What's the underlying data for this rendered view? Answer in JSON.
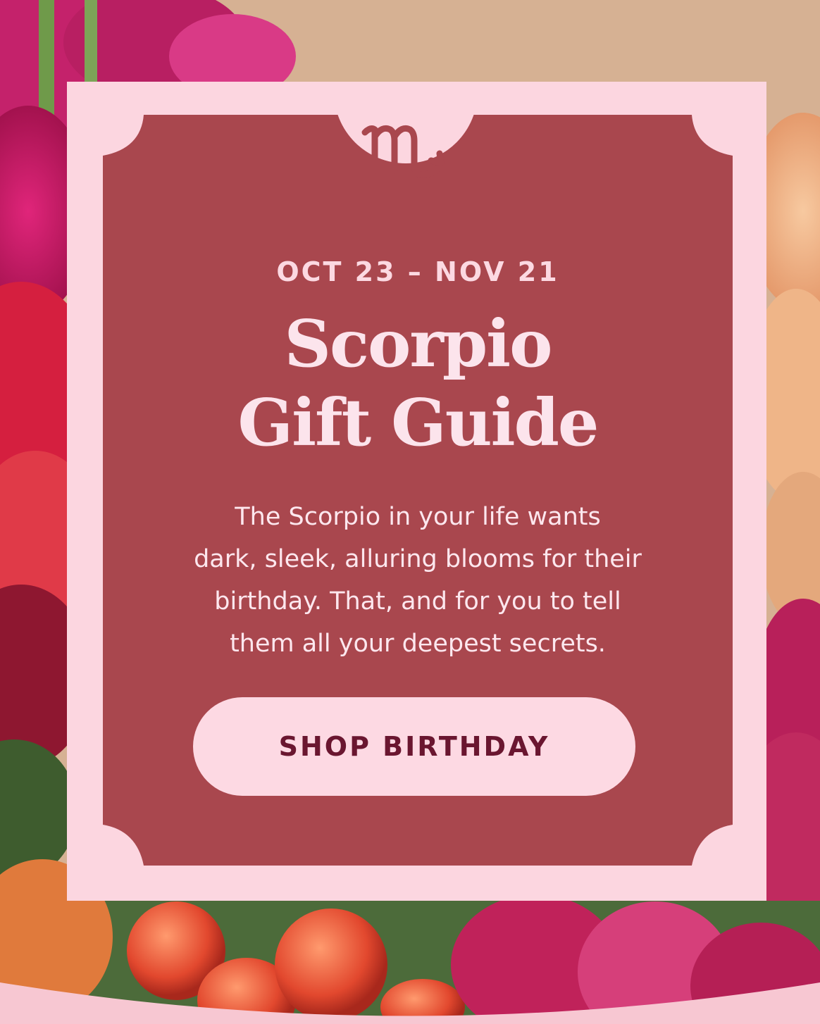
{
  "promo": {
    "date_range": "OCT 23 – NOV 21",
    "title_line1": "Scorpio",
    "title_line2": "Gift Guide",
    "description_lines": [
      "The Scorpio in your life wants",
      "dark, sleek, alluring blooms for their",
      "birthday. That, and for you to tell",
      "them all your deepest secrets."
    ],
    "cta_label": "SHOP BIRTHDAY",
    "zodiac_icon": "scorpio-glyph-icon"
  },
  "colors": {
    "card_bg": "#fcd6e0",
    "panel_bg": "#a9474e",
    "button_text": "#6a1630",
    "text_light": "#fce4ec"
  }
}
